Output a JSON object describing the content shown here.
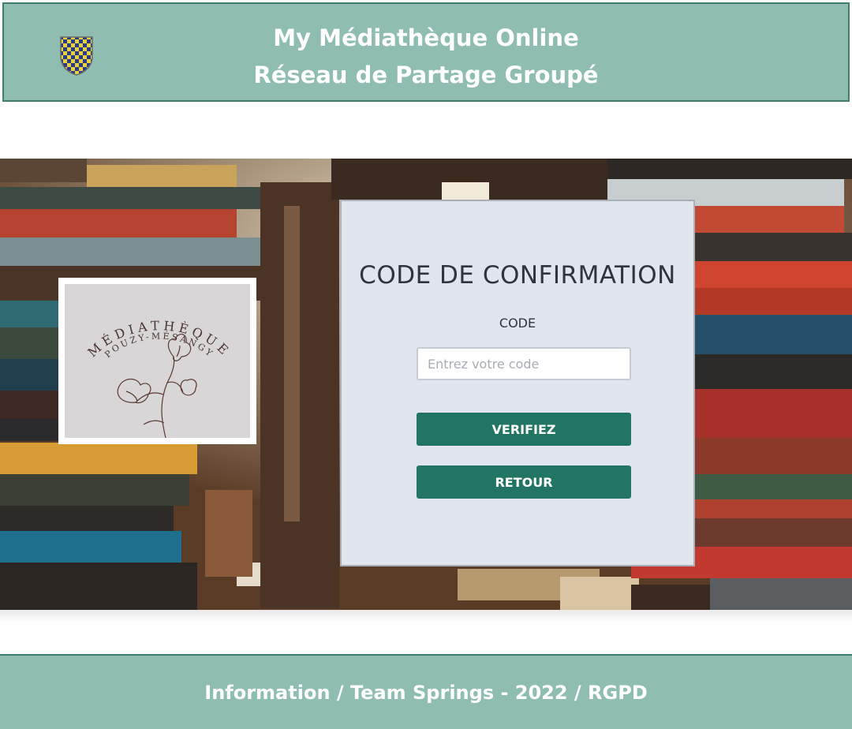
{
  "header": {
    "line1": "My Médiathèque Online",
    "line2": "Réseau de Partage Groupé"
  },
  "logo": {
    "arc_top": "MÉDIATHÈQUE",
    "arc_bottom": "POUZY-MÉSANGY"
  },
  "panel": {
    "title": "CODE DE CONFIRMATION",
    "code_label": "CODE",
    "code_placeholder": "Entrez votre code",
    "code_value": "",
    "verify_label": "VERIFIEZ",
    "back_label": "RETOUR"
  },
  "footer": {
    "text": "Information / Team Springs - 2022 / RGPD"
  },
  "colors": {
    "header_bg": "#8fbdb1",
    "header_border": "#3f7d6d",
    "button_bg": "#217562",
    "panel_bg": "#e0e5ee"
  }
}
